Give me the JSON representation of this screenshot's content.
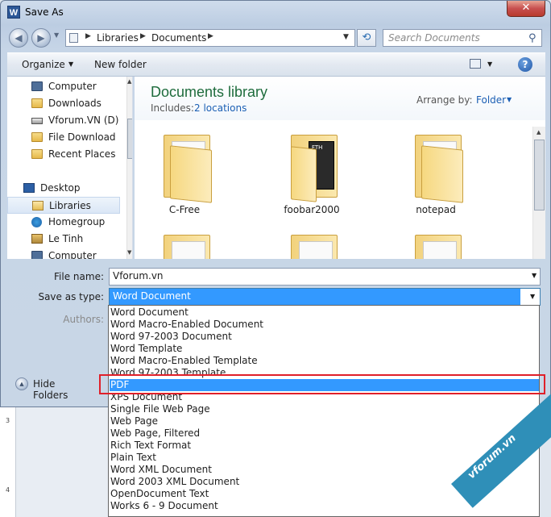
{
  "window": {
    "title": "Save As",
    "app_icon_letter": "W",
    "close_glyph": "✕"
  },
  "address_bar": {
    "crumbs": [
      "Libraries",
      "Documents"
    ],
    "search_placeholder": "Search Documents"
  },
  "toolbar": {
    "organize_label": "Organize",
    "new_folder_label": "New folder",
    "help_glyph": "?"
  },
  "nav_pane": {
    "items": [
      {
        "label": "Computer",
        "icon": "computer-icon"
      },
      {
        "label": "Downloads",
        "icon": "folder-icon"
      },
      {
        "label": "Vforum.VN (D)",
        "icon": "drive-icon"
      },
      {
        "label": "File Download",
        "icon": "folder-icon"
      },
      {
        "label": "Recent Places",
        "icon": "folder-icon"
      },
      {
        "label": "Desktop",
        "icon": "desktop-icon"
      },
      {
        "label": "Libraries",
        "icon": "libraries-icon",
        "selected": true
      },
      {
        "label": "Homegroup",
        "icon": "homegroup-icon"
      },
      {
        "label": "Le Tinh",
        "icon": "user-icon"
      },
      {
        "label": "Computer",
        "icon": "computer-icon"
      }
    ]
  },
  "library": {
    "title": "Documents library",
    "includes_label": "Includes:",
    "locations_link": "2 locations",
    "arrange_label": "Arrange by:",
    "arrange_value": "Folder",
    "folders": [
      "C-Free",
      "foobar2000",
      "notepad",
      "",
      "",
      ""
    ],
    "foobar_thumb_text": "FTH"
  },
  "form": {
    "file_name_label": "File name:",
    "file_name_value": "Vforum.vn",
    "save_type_label": "Save as type:",
    "save_type_value": "Word Document",
    "authors_label": "Authors:",
    "hide_folders_label": "Hide Folders"
  },
  "save_type_options": [
    "Word Document",
    "Word Macro-Enabled Document",
    "Word 97-2003 Document",
    "Word Template",
    "Word Macro-Enabled Template",
    "Word 97-2003 Template",
    "PDF",
    "XPS Document",
    "Single File Web Page",
    "Web Page",
    "Web Page, Filtered",
    "Rich Text Format",
    "Plain Text",
    "Word XML Document",
    "Word 2003 XML Document",
    "OpenDocument Text",
    "Works 6 - 9 Document"
  ],
  "highlighted_option": "PDF",
  "annotation_color": "#e0202a",
  "highlight_color": "#3399ff",
  "ruler_numbers": [
    "3",
    "4"
  ],
  "watermark": "vforum.vn"
}
